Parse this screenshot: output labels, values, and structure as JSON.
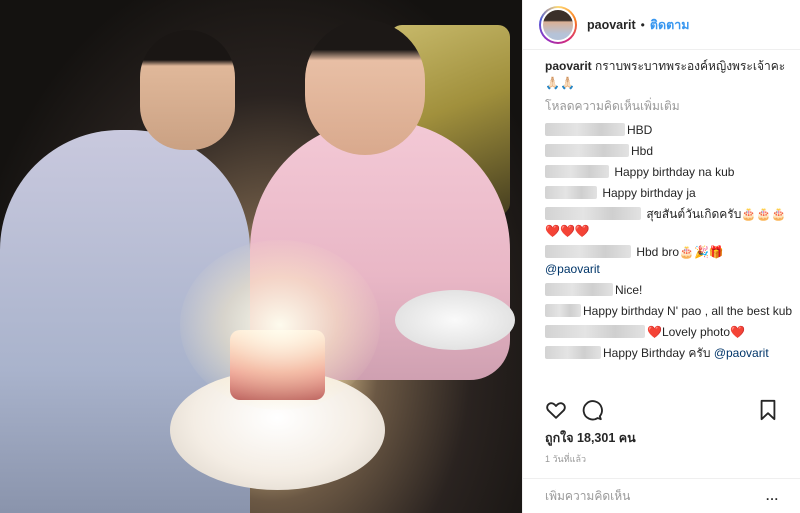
{
  "header": {
    "username": "paovarit",
    "separator": "•",
    "follow_label": "ติดตาม"
  },
  "caption": {
    "username": "paovarit",
    "text": "กราบพระบาทพระองค์หญิงพระเจ้าคะ",
    "emoji": "🙏🏻🙏🏻"
  },
  "load_more_label": "โหลดความคิดเห็นเพิ่มเติม",
  "comments": [
    {
      "text": "HBD"
    },
    {
      "text": "Hbd"
    },
    {
      "text": " Happy birthday na kub"
    },
    {
      "text": " Happy birthday ja"
    },
    {
      "text": " สุขสันต์วันเกิดครับ🎂🎂🎂❤️❤️❤️"
    },
    {
      "text": "Hbd bro🎂🎉🎁",
      "mention": "@paovarit"
    },
    {
      "text": "Nice!"
    },
    {
      "text": "Happy birthday N' pao , all the best kub"
    },
    {
      "text": "❤️Lovely photo❤️"
    },
    {
      "text": "Happy Birthday ครับ ",
      "mention": "@paovarit"
    }
  ],
  "icons": {
    "like": "heart-icon",
    "comment": "speech-bubble-icon",
    "save": "bookmark-icon",
    "more": "ellipsis-icon"
  },
  "likes_label": "ถูกใจ 18,301 คน",
  "time_label": "1 วันที่แล้ว",
  "add_comment_placeholder": "เพิ่มความคิดเห็น",
  "more_label": "..."
}
